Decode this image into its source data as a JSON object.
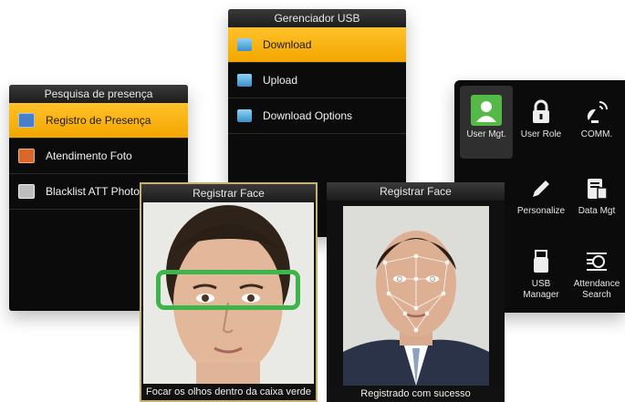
{
  "attendance_search_menu": {
    "title": "Pesquisa de presença",
    "items": [
      {
        "label": "Registro de Presença",
        "icon": "edit-record-icon",
        "selected": true
      },
      {
        "label": "Atendimento Foto",
        "icon": "attendance-photo-icon",
        "selected": false
      },
      {
        "label": "Blacklist ATT Photo",
        "icon": "blacklist-photo-icon",
        "selected": false
      }
    ]
  },
  "usb_manager_menu": {
    "title": "Gerenciador USB",
    "items": [
      {
        "label": "Download",
        "icon": "usb-download-icon",
        "selected": true
      },
      {
        "label": "Upload",
        "icon": "usb-upload-icon",
        "selected": false
      },
      {
        "label": "Download Options",
        "icon": "usb-options-icon",
        "selected": false
      }
    ]
  },
  "main_menu_grid": {
    "items": [
      {
        "label": "User Mgt.",
        "icon": "user-icon",
        "selected": true
      },
      {
        "label": "User Role",
        "icon": "lock-icon",
        "selected": false
      },
      {
        "label": "COMM.",
        "icon": "satellite-dish-icon",
        "selected": false
      },
      {
        "label": "Personalize",
        "icon": "pencil-icon",
        "selected": false
      },
      {
        "label": "Data Mgt",
        "icon": "database-icon",
        "selected": false
      },
      {
        "label": "USB Manager",
        "icon": "usb-stick-icon",
        "selected": false
      },
      {
        "label": "Attendance Search",
        "icon": "attendance-search-icon",
        "selected": false
      }
    ]
  },
  "register_face_left": {
    "title": "Registrar Face",
    "caption": "Focar os olhos dentro da caixa verde",
    "guide_box_color": "#3db54a"
  },
  "register_face_right": {
    "title": "Registrar Face",
    "caption": "Registrado com sucesso"
  },
  "colors": {
    "highlight": "#f7b00d",
    "panel_bg": "#0b0b0b",
    "guide_green": "#3db54a",
    "grid_selected_icon_bg": "#55b947"
  }
}
